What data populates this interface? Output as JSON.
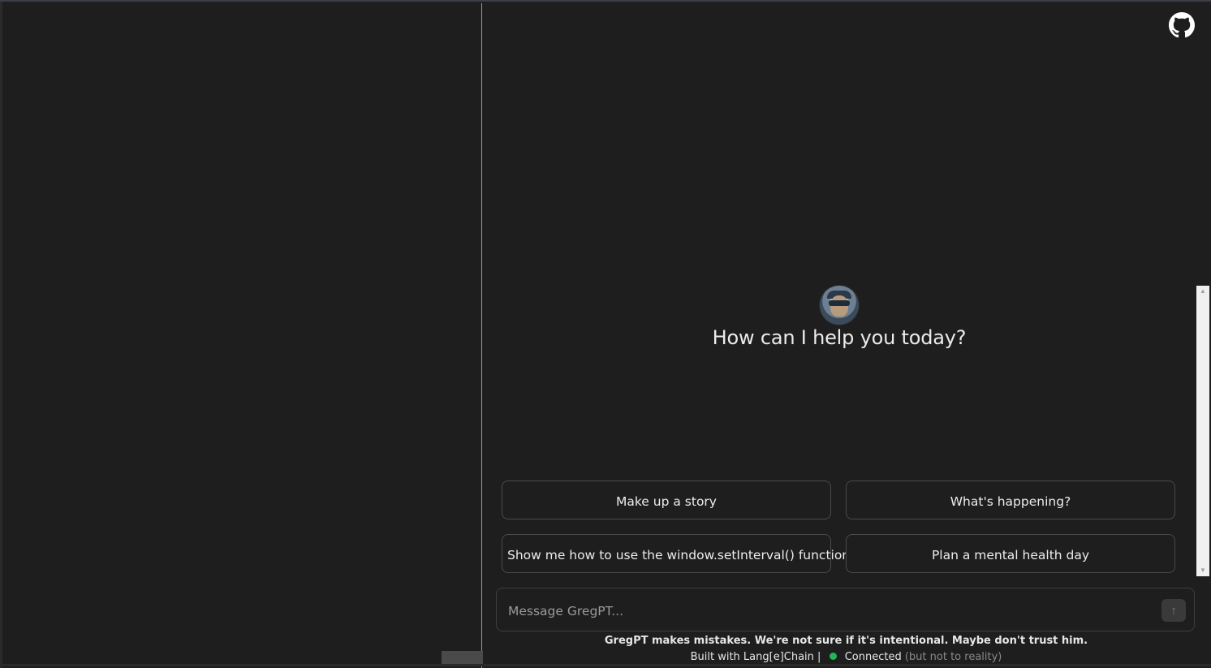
{
  "header": {
    "github_icon": "github-icon"
  },
  "sidebar": {
    "tag": ""
  },
  "main": {
    "greeting": "How can I help you today?",
    "avatar_icon": "avatar-image",
    "suggestions": [
      "Make up a story",
      "What's happening?",
      "Show me how to use the window.setInterval() function",
      "Plan a mental health day"
    ]
  },
  "composer": {
    "placeholder": "Message GregPT...",
    "value": "",
    "send_icon": "arrow-up-icon",
    "send_glyph": "↑"
  },
  "footer": {
    "disclaimer": "GregPT makes mistakes. We're not sure if it's intentional. Maybe don't trust him.",
    "built_with": "Built with Lang[e]Chain |",
    "status": "Connected",
    "status_note": "(but not to reality)",
    "status_color": "#1db954"
  },
  "colors": {
    "background": "#1e1e1e",
    "text": "#ececec",
    "border": "#4a4a4a"
  }
}
